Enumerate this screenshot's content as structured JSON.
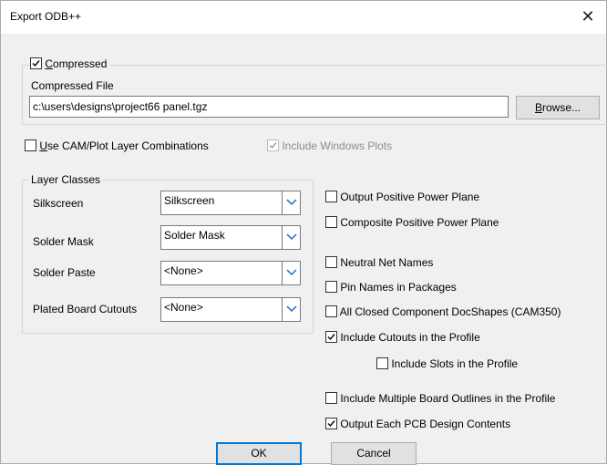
{
  "window": {
    "title": "Export ODB++",
    "close_glyph": "✕"
  },
  "compressed": {
    "checked": true,
    "label_first": "C",
    "label_rest": "ompressed"
  },
  "compressed_file": {
    "label": "Compressed File",
    "value": "c:\\users\\designs\\project66 panel.tgz",
    "browse_first": "B",
    "browse_rest": "rowse..."
  },
  "use_cam": {
    "checked": false,
    "label_first": "U",
    "label_rest": "se CAM/Plot Layer Combinations"
  },
  "include_windows_plots": {
    "checked": true,
    "disabled": true,
    "label": "Include Windows Plots"
  },
  "layer_classes": {
    "title": "Layer Classes",
    "rows": [
      {
        "label": "Silkscreen",
        "value": "Silkscreen"
      },
      {
        "label": "Solder Mask",
        "value": "Solder Mask"
      },
      {
        "label": "Solder Paste",
        "value": "<None>"
      },
      {
        "label": "Plated Board Cutouts",
        "value": "<None>"
      }
    ]
  },
  "options": [
    {
      "label": "Output Positive Power Plane",
      "checked": false
    },
    {
      "label": "Composite Positive Power Plane",
      "checked": false
    },
    {
      "label": "Neutral Net Names",
      "checked": false
    },
    {
      "label": "Pin Names in Packages",
      "checked": false
    },
    {
      "label": "All Closed Component DocShapes (CAM350)",
      "checked": false
    },
    {
      "label": "Include Cutouts in the Profile",
      "checked": true
    },
    {
      "label": "Include Slots in the Profile",
      "checked": false
    },
    {
      "label": "Include Multiple Board Outlines in the Profile",
      "checked": false
    },
    {
      "label": "Output Each PCB Design Contents",
      "checked": true
    }
  ],
  "buttons": {
    "ok": "OK",
    "cancel": "Cancel"
  },
  "colors": {
    "accent": "#0078d7",
    "dialog_bg": "#f0f0f0",
    "titlebar_bg": "#ffffff"
  }
}
